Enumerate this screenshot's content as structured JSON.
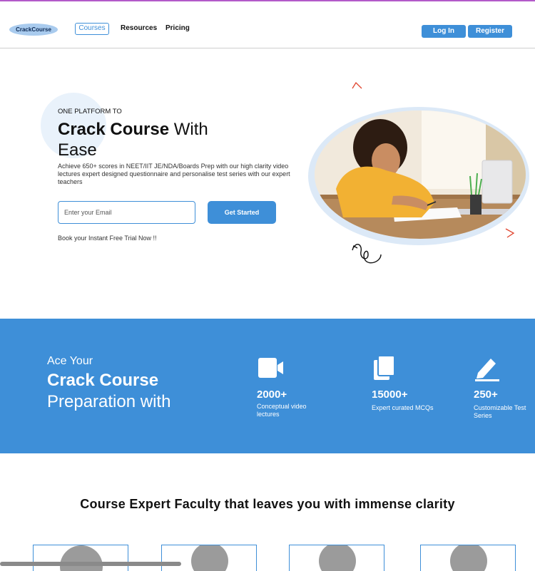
{
  "brand": {
    "logo": "CrackCourse"
  },
  "nav": {
    "links": [
      "Courses",
      "Resources",
      "Pricing"
    ],
    "login": "Log In",
    "register": "Register"
  },
  "hero": {
    "eyebrow": "ONE PLATFORM TO",
    "headline_bold": "Crack Course",
    "headline_rest": " With Ease",
    "description": "Achieve 650+ scores in NEET/IIT JE/NDA/Boards Prep with our high clarity video lectures expert designed questionnaire and personalise test series with our expert teachers",
    "email_placeholder": "Enter your Email",
    "cta": "Get Started",
    "trial_note": "Book your Instant Free Trial Now !!"
  },
  "stats": {
    "ace_line1": "Ace Your",
    "ace_line2": "Crack Course",
    "ace_line3": "Preparation with",
    "items": [
      {
        "icon": "video-camera-icon",
        "value": "2000+",
        "label": "Conceptual video lectures"
      },
      {
        "icon": "copy-pages-icon",
        "value": "15000+",
        "label": "Expert curated MCQs"
      },
      {
        "icon": "pencil-edit-icon",
        "value": "250+",
        "label": "Customizable Test Series"
      }
    ]
  },
  "faculty": {
    "title": "Course Expert Faculty that leaves you with immense clarity"
  },
  "colors": {
    "accent": "#3e8fd8",
    "accent_light": "#a9cbee",
    "top_border": "#b35ac9"
  }
}
